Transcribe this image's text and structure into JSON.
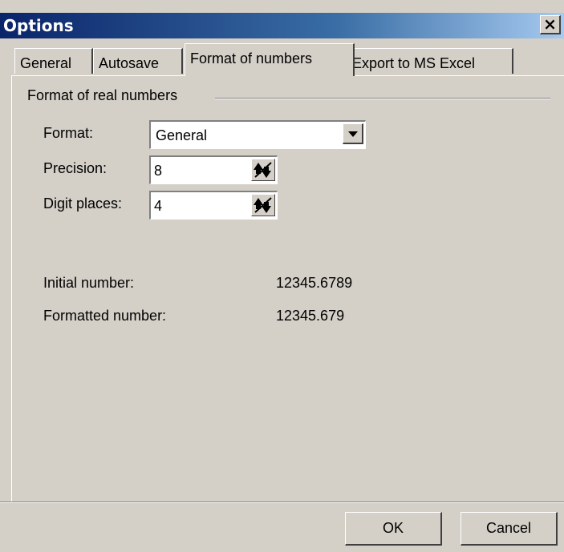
{
  "window": {
    "title": "Options",
    "close_glyph": "×"
  },
  "tabs": [
    {
      "label": "General",
      "active": false
    },
    {
      "label": "Autosave",
      "active": false
    },
    {
      "label": "Format of numbers",
      "active": true
    },
    {
      "label": "Export to MS Excel",
      "active": false
    }
  ],
  "group": {
    "title": "Format of real numbers"
  },
  "fields": {
    "format": {
      "label": "Format:",
      "value": "General"
    },
    "precision": {
      "label": "Precision:",
      "value": "8"
    },
    "digit_places": {
      "label": "Digit places:",
      "value": "4"
    }
  },
  "preview": {
    "initial_label": "Initial number:",
    "initial_value": "12345.6789",
    "formatted_label": "Formatted number:",
    "formatted_value": "12345.679"
  },
  "buttons": {
    "ok": "OK",
    "cancel": "Cancel"
  },
  "icons": {
    "close": "close-icon",
    "dropdown": "chevron-down-icon",
    "spinner": "spinner-icon"
  },
  "colors": {
    "face": "#d4d0c8",
    "title_start": "#0a246a",
    "title_end": "#a6caf0"
  }
}
